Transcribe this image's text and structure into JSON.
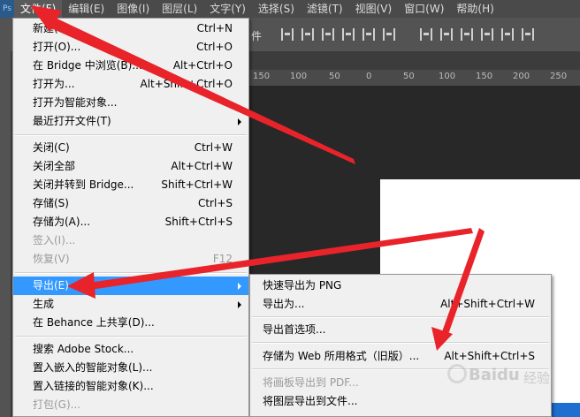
{
  "menubar": {
    "items": [
      "文件(F)",
      "编辑(E)",
      "图像(I)",
      "图层(L)",
      "文字(Y)",
      "选择(S)",
      "滤镜(T)",
      "视图(V)",
      "窗口(W)",
      "帮助(H)"
    ]
  },
  "optionsbar": {
    "text_fragment": "件"
  },
  "ruler": {
    "labels": [
      "150",
      "100",
      "50",
      "0",
      "50",
      "100",
      "150",
      "200",
      "250"
    ]
  },
  "file_menu": {
    "items": [
      {
        "label": "新建(N)...",
        "shortcut": "Ctrl+N"
      },
      {
        "label": "打开(O)...",
        "shortcut": "Ctrl+O"
      },
      {
        "label": "在 Bridge 中浏览(B)...",
        "shortcut": "Alt+Ctrl+O"
      },
      {
        "label": "打开为...",
        "shortcut": "Alt+Shift+Ctrl+O"
      },
      {
        "label": "打开为智能对象...",
        "shortcut": ""
      },
      {
        "label": "最近打开文件(T)",
        "shortcut": ""
      },
      {
        "label": "关闭(C)",
        "shortcut": "Ctrl+W"
      },
      {
        "label": "关闭全部",
        "shortcut": "Alt+Ctrl+W"
      },
      {
        "label": "关闭并转到 Bridge...",
        "shortcut": "Shift+Ctrl+W"
      },
      {
        "label": "存储(S)",
        "shortcut": "Ctrl+S"
      },
      {
        "label": "存储为(A)...",
        "shortcut": "Shift+Ctrl+S"
      },
      {
        "label": "签入(I)...",
        "shortcut": ""
      },
      {
        "label": "恢复(V)",
        "shortcut": "F12"
      },
      {
        "label": "导出(E)",
        "shortcut": ""
      },
      {
        "label": "生成",
        "shortcut": ""
      },
      {
        "label": "在 Behance 上共享(D)...",
        "shortcut": ""
      },
      {
        "label": "搜索 Adobe Stock...",
        "shortcut": ""
      },
      {
        "label": "置入嵌入的智能对象(L)...",
        "shortcut": ""
      },
      {
        "label": "置入链接的智能对象(K)...",
        "shortcut": ""
      },
      {
        "label": "打包(G)...",
        "shortcut": ""
      }
    ]
  },
  "export_submenu": {
    "items": [
      {
        "label": "快速导出为 PNG",
        "shortcut": ""
      },
      {
        "label": "导出为...",
        "shortcut": "Alt+Shift+Ctrl+W"
      },
      {
        "label": "导出首选项...",
        "shortcut": ""
      },
      {
        "label": "存储为 Web 所用格式（旧版）...",
        "shortcut": "Alt+Shift+Ctrl+S"
      },
      {
        "label": "将画板导出到 PDF...",
        "shortcut": ""
      },
      {
        "label": "将图层导出到文件...",
        "shortcut": ""
      }
    ]
  },
  "watermark": {
    "brand": "Baidu",
    "suffix": "经验"
  },
  "annotation_color": "#e8232a",
  "highlight_color": "#3399ff"
}
